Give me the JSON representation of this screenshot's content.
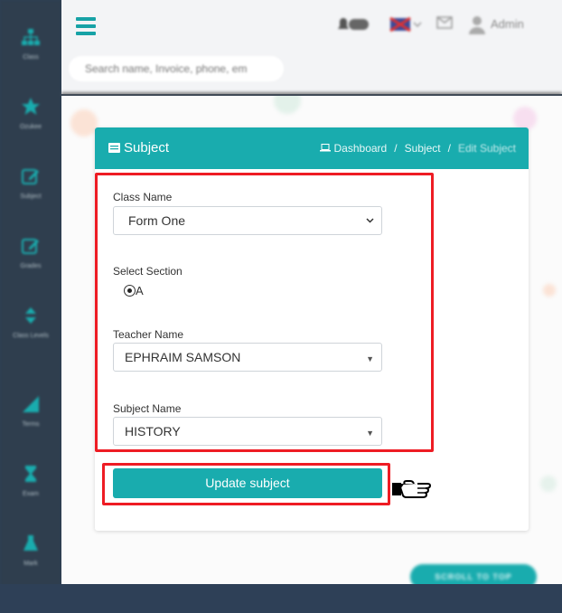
{
  "sidebar": {
    "items": [
      {
        "label": "Class",
        "icon": "sitemap-icon"
      },
      {
        "label": "Ozukee",
        "icon": "star-icon"
      },
      {
        "label": "Subject",
        "icon": "edit-icon"
      },
      {
        "label": "Grades",
        "icon": "edit-icon"
      },
      {
        "label": "Class Levels",
        "icon": "sort-icon"
      },
      {
        "label": "Terms",
        "icon": "signal-icon"
      },
      {
        "label": "Exam",
        "icon": "hourglass-icon"
      },
      {
        "label": "Mark",
        "icon": "flask-icon"
      }
    ]
  },
  "topbar": {
    "search_placeholder": "Search name, Invoice, phone, em",
    "user_name": "Admin"
  },
  "card": {
    "title": "Subject",
    "breadcrumb": {
      "dashboard": "Dashboard",
      "subject": "Subject",
      "current": "Edit Subject"
    }
  },
  "form": {
    "class_name_label": "Class Name",
    "class_name_value": "Form One",
    "section_label": "Select Section",
    "section_option": "A",
    "teacher_label": "Teacher Name",
    "teacher_value": "EPHRAIM SAMSON",
    "subject_label": "Subject Name",
    "subject_value": "HISTORY",
    "submit_label": "Update subject"
  },
  "scroll_top_label": "SCROLL TO TOP",
  "colors": {
    "accent": "#19acae",
    "sidebar": "#2f3e4e",
    "highlight": "#ee1c24"
  }
}
